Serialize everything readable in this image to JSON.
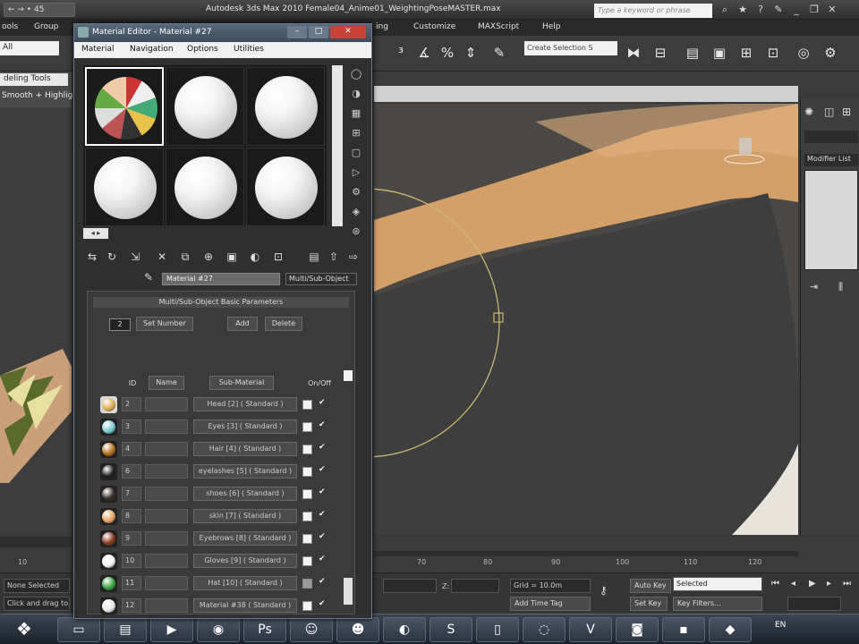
{
  "app": {
    "title": "Autodesk 3ds Max 2010    Female04_Anime01_WeightingPoseMASTER.max",
    "search_placeholder": "Type a keyword or phrase",
    "quick_access": "← → • 45"
  },
  "menu": [
    "ools",
    "Group",
    "ing",
    "Customize",
    "MAXScript",
    "Help"
  ],
  "toolbar": {
    "filter": "All",
    "selection_set": "Create Selection S"
  },
  "ribbon": {
    "tab": "deling Tools",
    "mode": "Smooth + Highligh"
  },
  "material_editor": {
    "title": "Material Editor - Material #27",
    "menu": [
      "Material",
      "Navigation",
      "Options",
      "Utilities"
    ],
    "material_name": "Material #27",
    "material_type": "Multi/Sub-Object",
    "rollout_title": "Multi/Sub-Object Basic Parameters",
    "count": "2",
    "set_number": "Set Number",
    "add": "Add",
    "delete": "Delete",
    "col_id": "ID",
    "col_name": "Name",
    "col_submat": "Sub-Material",
    "col_onoff": "On/Off",
    "rows": [
      {
        "id": "2",
        "sub": "Head [2] ( Standard )",
        "color": "#e0a850"
      },
      {
        "id": "3",
        "sub": "Eyes [3] ( Standard )",
        "color": "#7ac8d4"
      },
      {
        "id": "4",
        "sub": "Hair [4] ( Standard )",
        "color": "#b8701c"
      },
      {
        "id": "6",
        "sub": "eyelashes [5] ( Standard )",
        "color": "#1e1e1e"
      },
      {
        "id": "7",
        "sub": "shoes [6] ( Standard )",
        "color": "#3a2e26"
      },
      {
        "id": "8",
        "sub": "skin [7] ( Standard )",
        "color": "#e9a060"
      },
      {
        "id": "9",
        "sub": "Eyebrows [8] ( Standard )",
        "color": "#8a3a1c"
      },
      {
        "id": "10",
        "sub": "Gloves [9] ( Standard )",
        "color": "#f2f2f2"
      },
      {
        "id": "11",
        "sub": "Hat [10] ( Standard )",
        "color": "#3aa43a"
      },
      {
        "id": "12",
        "sub": "Material #38 ( Standard )",
        "color": "#e8e8e8"
      }
    ]
  },
  "timeline": {
    "ticks": [
      "10",
      "70",
      "80",
      "90",
      "100",
      "110",
      "120"
    ]
  },
  "status": {
    "selected": "None Selected",
    "prompt": "Click and drag to",
    "z_label": "Z:",
    "grid": "Grid = 10.0m",
    "add_time_tag": "Add Time Tag",
    "auto_key": "Auto Key",
    "set_key": "Set Key",
    "key_mode": "Selected",
    "key_filters": "Key Filters..."
  },
  "command_panel": {
    "modifier_list": "Modifier List"
  },
  "taskbar": {
    "lang": "EN"
  },
  "colors": {
    "title_blue": "#586a7e",
    "viewport_bg": "#4f4c48",
    "skin": "#d8a264"
  }
}
